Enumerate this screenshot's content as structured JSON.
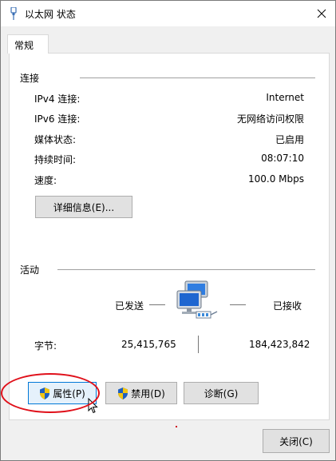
{
  "window": {
    "title": "以太网 状态"
  },
  "tabs": [
    {
      "label": "常规"
    }
  ],
  "connection": {
    "section_title": "连接",
    "rows": [
      {
        "label": "IPv4 连接:",
        "value": "Internet"
      },
      {
        "label": "IPv6 连接:",
        "value": "无网络访问权限"
      },
      {
        "label": "媒体状态:",
        "value": "已启用"
      },
      {
        "label": "持续时间:",
        "value": "08:07:10"
      },
      {
        "label": "速度:",
        "value": "100.0 Mbps"
      }
    ],
    "details_button": "详细信息(E)..."
  },
  "activity": {
    "section_title": "活动",
    "sent_label": "已发送",
    "received_label": "已接收",
    "bytes_label": "字节:",
    "bytes_sent": "25,415,765",
    "bytes_received": "184,423,842"
  },
  "buttons": {
    "properties": "属性(P)",
    "disable": "禁用(D)",
    "diagnose": "诊断(G)",
    "close": "关闭(C)"
  },
  "colors": {
    "highlight_oval": "#e0101a",
    "shield_blue": "#1f5fbf",
    "shield_yellow": "#f2c511"
  },
  "icons": [
    "ethernet-icon",
    "close-icon",
    "shield-icon",
    "network-computers-icon"
  ]
}
